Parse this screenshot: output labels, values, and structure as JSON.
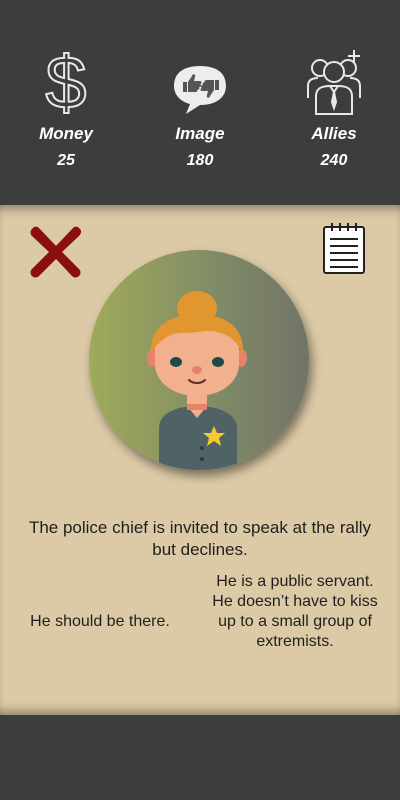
{
  "stats": [
    {
      "label": "Money",
      "value": "25",
      "icon": "dollar-sign-icon"
    },
    {
      "label": "Image",
      "value": "180",
      "icon": "thumbs-up-down-icon"
    },
    {
      "label": "Allies",
      "value": "240",
      "icon": "add-allies-icon"
    }
  ],
  "card": {
    "scenario": "The police chief is invited to speak at the rally but declines.",
    "choice_left": "He should be there.",
    "choice_right": "He is a public servant. He doesn’t have to kiss up to a small group of extremists.",
    "close_icon": "close-icon",
    "notes_icon": "notepad-icon",
    "colors": {
      "card_bg": "#dccaa6",
      "bar_bg": "#3d3d3d",
      "close_red": "#8c0f0f"
    }
  }
}
